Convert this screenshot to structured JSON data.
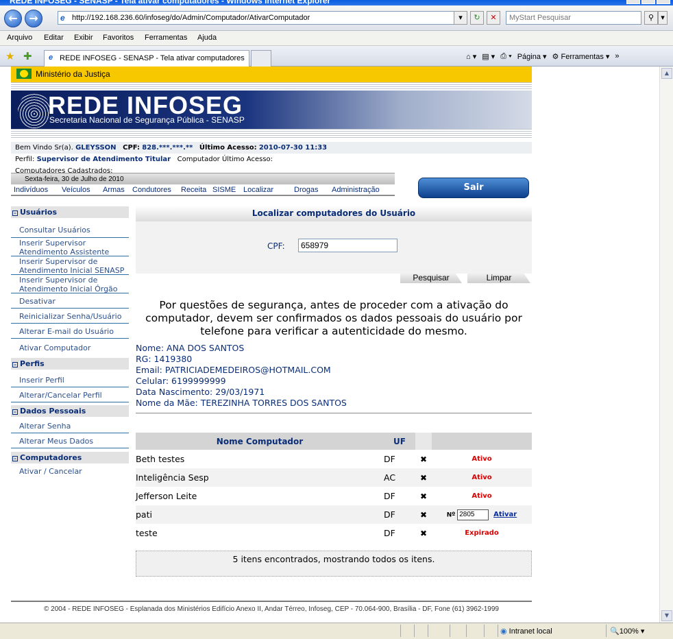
{
  "browser": {
    "title": "REDE INFOSEG - SENASP - Tela ativar computadores - Windows Internet Explorer",
    "url": "http://192.168.236.60/infoseg/do/Admin/Computador/AtivarComputador",
    "search_placeholder": "MyStart Pesquisar",
    "menu": [
      "Arquivo",
      "Editar",
      "Exibir",
      "Favoritos",
      "Ferramentas",
      "Ajuda"
    ],
    "tab_title": "REDE INFOSEG - SENASP - Tela ativar computadores",
    "tools": {
      "page": "Página",
      "tools": "Ferramentas"
    },
    "status": {
      "zone": "Intranet local",
      "zoom": "100%"
    }
  },
  "site": {
    "ministry": "Ministério da Justiça",
    "brand": "REDE INFOSEG",
    "brand_sub": "Secretaria Nacional de Segurança Pública - SENASP",
    "user": {
      "welcome_label": "Bem Vindo Sr(a).",
      "name": "GLEYSSON",
      "cpf_label": "CPF:",
      "cpf": "828.***.***.**",
      "last_access_label": "Último Acesso:",
      "last_access": "2010-07-30 11:33",
      "profile_label": "Perfil:",
      "profile": "Supervisor de Atendimento Titular",
      "last_computer_label": "Computador Último Acesso:",
      "registered_label": "Computadores Cadastrados:"
    },
    "date": "Sexta-feira, 30 de Julho de 2010",
    "logout": "Sair",
    "nav": [
      "Indivíduos",
      "Veículos",
      "Armas",
      "Condutores",
      "Receita",
      "SISME",
      "Localizar",
      "Drogas",
      "Administração"
    ]
  },
  "sidebar": {
    "sections": [
      {
        "title": "Usuários",
        "items": [
          "Consultar Usuários",
          "Inserir Supervisor Atendimento Assistente",
          "Inserir Supervisor de Atendimento Inicial SENASP",
          "Inserir Supervisor de Atendimento Inicial Órgão",
          "Desativar",
          "Reinicializar Senha/Usuário",
          "Alterar E-mail do Usuário",
          "Ativar Computador"
        ]
      },
      {
        "title": "Perfis",
        "items": [
          "Inserir Perfil",
          "Alterar/Cancelar Perfil"
        ]
      },
      {
        "title": "Dados Pessoais",
        "items": [
          "Alterar Senha",
          "Alterar Meus Dados"
        ]
      },
      {
        "title": "Computadores",
        "items": [
          "Ativar / Cancelar"
        ]
      }
    ]
  },
  "main": {
    "title": "Localizar computadores do Usuário",
    "cpf_label": "CPF:",
    "cpf_value": "658979",
    "search_btn": "Pesquisar",
    "clear_btn": "Limpar",
    "notice": "Por questões de segurança, antes de proceder com a ativação do computador, devem ser confirmados os dados pessoais do usuário por telefone para verificar a autenticidade do mesmo.",
    "person": {
      "nome": "Nome: ANA DOS SANTOS",
      "rg": "RG: 1419380",
      "email": "Email: PATRICIADEMEDEIROS@HOTMAIL.COM",
      "celular": "Celular: 6199999999",
      "nascimento": "Data Nascimento: 29/03/1971",
      "mae": "Nome da Mãe: TEREZINHA TORRES DOS SANTOS"
    },
    "table": {
      "headers": [
        "Nome Computador",
        "UF",
        "",
        ""
      ],
      "rows": [
        {
          "name": "Beth testes",
          "uf": "DF",
          "status": "Ativo"
        },
        {
          "name": "Inteligência Sesp",
          "uf": "AC",
          "status": "Ativo"
        },
        {
          "name": "Jefferson Leite",
          "uf": "DF",
          "status": "Ativo"
        },
        {
          "name": "pati",
          "uf": "DF",
          "num_label": "Nº",
          "num_value": "2805",
          "action": "Ativar"
        },
        {
          "name": "teste",
          "uf": "DF",
          "status": "Expirado"
        }
      ],
      "delete_glyph": "✖"
    },
    "results": "5 itens encontrados, mostrando todos os itens."
  },
  "footer": "© 2004 - REDE INFOSEG - Esplanada dos Ministérios Edifício Anexo II, Andar Térreo, Infoseg, CEP - 70.064-900, Brasília - DF, Fone (61) 3962-1999"
}
